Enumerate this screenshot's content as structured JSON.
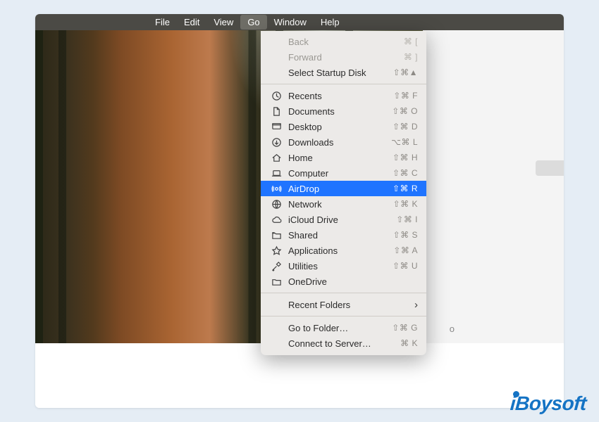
{
  "menubar": {
    "items": [
      {
        "label": "File"
      },
      {
        "label": "Edit"
      },
      {
        "label": "View"
      },
      {
        "label": "Go"
      },
      {
        "label": "Window"
      },
      {
        "label": "Help"
      }
    ]
  },
  "dropdown": {
    "nav": {
      "back": {
        "label": "Back",
        "shortcut": "⌘ ["
      },
      "forward": {
        "label": "Forward",
        "shortcut": "⌘ ]"
      },
      "startup": {
        "label": "Select Startup Disk",
        "shortcut": "⇧⌘▲"
      }
    },
    "places": [
      {
        "icon": "clock",
        "label": "Recents",
        "shortcut": "⇧⌘ F"
      },
      {
        "icon": "doc",
        "label": "Documents",
        "shortcut": "⇧⌘ O"
      },
      {
        "icon": "desktop",
        "label": "Desktop",
        "shortcut": "⇧⌘ D"
      },
      {
        "icon": "download",
        "label": "Downloads",
        "shortcut": "⌥⌘ L"
      },
      {
        "icon": "home",
        "label": "Home",
        "shortcut": "⇧⌘ H"
      },
      {
        "icon": "laptop",
        "label": "Computer",
        "shortcut": "⇧⌘ C"
      },
      {
        "icon": "airdrop",
        "label": "AirDrop",
        "shortcut": "⇧⌘ R"
      },
      {
        "icon": "globe",
        "label": "Network",
        "shortcut": "⇧⌘ K"
      },
      {
        "icon": "cloud",
        "label": "iCloud Drive",
        "shortcut": "⇧⌘ I"
      },
      {
        "icon": "shared",
        "label": "Shared",
        "shortcut": "⇧⌘ S"
      },
      {
        "icon": "apps",
        "label": "Applications",
        "shortcut": "⇧⌘ A"
      },
      {
        "icon": "utilities",
        "label": "Utilities",
        "shortcut": "⇧⌘ U"
      },
      {
        "icon": "folder",
        "label": "OneDrive",
        "shortcut": ""
      }
    ],
    "recent": {
      "label": "Recent Folders"
    },
    "gotofolder": {
      "label": "Go to Folder…",
      "shortcut": "⇧⌘ G"
    },
    "connect": {
      "label": "Connect to Server…",
      "shortcut": "⌘ K"
    }
  },
  "watermark": {
    "text": "iBoysoft"
  }
}
